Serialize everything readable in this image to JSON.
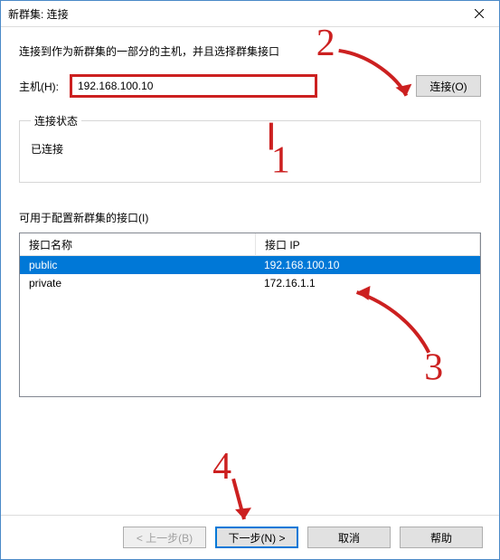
{
  "window": {
    "title": "新群集: 连接"
  },
  "instruction": "连接到作为新群集的一部分的主机，并且选择群集接口",
  "host": {
    "label": "主机(H):",
    "value": "192.168.100.10",
    "connect_label": "连接(O)"
  },
  "status_group": {
    "legend": "连接状态",
    "text": "已连接"
  },
  "interfaces": {
    "label": "可用于配置新群集的接口(I)",
    "columns": {
      "name": "接口名称",
      "ip": "接口 IP"
    },
    "rows": [
      {
        "name": "public",
        "ip": "192.168.100.10",
        "selected": true
      },
      {
        "name": "private",
        "ip": "172.16.1.1",
        "selected": false
      }
    ]
  },
  "buttons": {
    "back": "< 上一步(B)",
    "next": "下一步(N) >",
    "cancel": "取消",
    "help": "帮助"
  },
  "annotations": {
    "n1": "1",
    "n2": "2",
    "n3": "3",
    "n4": "4",
    "color": "#cc2020"
  }
}
